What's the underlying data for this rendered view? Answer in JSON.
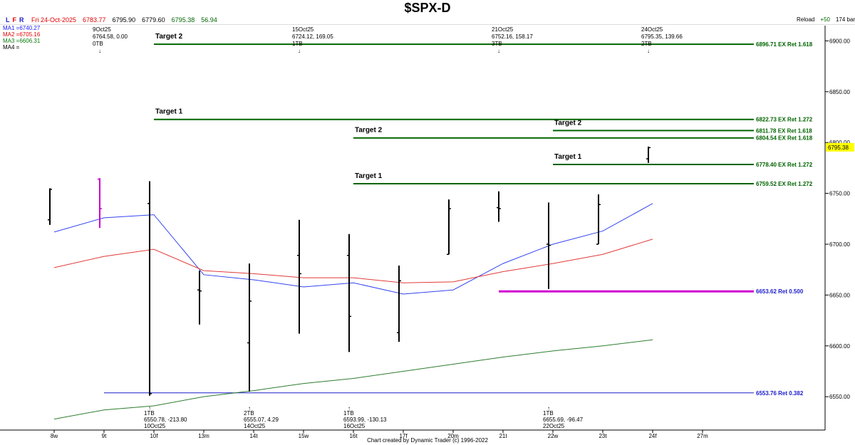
{
  "header": {
    "title": "$SPX-D",
    "lfr": [
      "L",
      "F",
      "R"
    ],
    "ohlc": {
      "date": "Fri 24-Oct-2025",
      "open": "6783.77",
      "high": "6795.90",
      "low": "6779.60",
      "close": "6795.38",
      "change": "56.94"
    },
    "reload_label": "Reload",
    "plus_label": "+50",
    "bars_label": "174 bars"
  },
  "moving_averages": [
    {
      "label": "MA1 =6740.27",
      "color": "#1a1aff"
    },
    {
      "label": "MA2 =6705.16",
      "color": "#e00000"
    },
    {
      "label": "MA3 =6606.31",
      "color": "#0a7a0a"
    },
    {
      "label": "MA4 =",
      "color": "#000000"
    }
  ],
  "footer": "Chart created by Dynamic Trader  (c) 1996-2022",
  "colors": {
    "target_line": "#006400",
    "ma1": "#3344ee",
    "ma2": "#e23a3a",
    "ma3": "#2e7d2e",
    "ret_blue": "#1a1acc",
    "ret_magenta": "#d000d0",
    "price_tag": "#ffff00"
  },
  "chart_data": {
    "type": "ohlc",
    "title": "$SPX-D",
    "ylim": [
      6520,
      6915
    ],
    "y_ticks": [
      6550,
      6600,
      6650,
      6700,
      6750,
      6800,
      6850,
      6900
    ],
    "y_tick_labels": [
      "6550.00",
      "6600.00",
      "6650.00",
      "6700.00",
      "6750.00",
      "6800.00",
      "6850.00",
      "6900.00"
    ],
    "categories": [
      "8w",
      "9t",
      "10f",
      "13m",
      "14t",
      "15w",
      "16t",
      "17f",
      "20m",
      "21t",
      "22w",
      "23t",
      "24f",
      "27m"
    ],
    "bars": [
      {
        "x": "8w",
        "open": 6724,
        "high": 6755,
        "low": 6719,
        "close": 6754
      },
      {
        "x": "9t",
        "open": 6764,
        "high": 6765,
        "low": 6716,
        "close": 6735,
        "highlight": true
      },
      {
        "x": "10f",
        "open": 6740,
        "high": 6762,
        "low": 6551,
        "close": 6553
      },
      {
        "x": "13m",
        "open": 6655,
        "high": 6674,
        "low": 6621,
        "close": 6654
      },
      {
        "x": "14t",
        "open": 6603,
        "high": 6681,
        "low": 6555,
        "close": 6644
      },
      {
        "x": "15w",
        "open": 6689,
        "high": 6724,
        "low": 6612,
        "close": 6671
      },
      {
        "x": "16t",
        "open": 6689,
        "high": 6710,
        "low": 6594,
        "close": 6629
      },
      {
        "x": "17f",
        "open": 6613,
        "high": 6679,
        "low": 6604,
        "close": 6664
      },
      {
        "x": "20m",
        "open": 6690,
        "high": 6744,
        "low": 6690,
        "close": 6735
      },
      {
        "x": "21t",
        "open": 6736,
        "high": 6752,
        "low": 6722,
        "close": 6735
      },
      {
        "x": "22w",
        "open": 6700,
        "high": 6741,
        "low": 6656,
        "close": 6699
      },
      {
        "x": "23t",
        "open": 6700,
        "high": 6749,
        "low": 6700,
        "close": 6739
      },
      {
        "x": "24f",
        "open": 6784,
        "high": 6796,
        "low": 6780,
        "close": 6795
      }
    ],
    "series": [
      {
        "name": "MA1",
        "x": [
          "8w",
          "9t",
          "10f",
          "13m",
          "14t",
          "15w",
          "16t",
          "17f",
          "20m",
          "21t",
          "22w",
          "23t",
          "24f"
        ],
        "values": [
          6712,
          6726,
          6729,
          6670,
          6665,
          6658,
          6662,
          6651,
          6655,
          6681,
          6700,
          6713,
          6740
        ]
      },
      {
        "name": "MA2",
        "x": [
          "8w",
          "9t",
          "10f",
          "13m",
          "14t",
          "15w",
          "16t",
          "17f",
          "20m",
          "21t",
          "22w",
          "23t",
          "24f"
        ],
        "values": [
          6677,
          6688,
          6695,
          6674,
          6671,
          6667,
          6667,
          6662,
          6663,
          6673,
          6681,
          6690,
          6705
        ]
      },
      {
        "name": "MA3",
        "x": [
          "8w",
          "9t",
          "10f",
          "13m",
          "14t",
          "15w",
          "16t",
          "17f",
          "20m",
          "21t",
          "22w",
          "23t",
          "24f"
        ],
        "values": [
          6528,
          6537,
          6541,
          6550,
          6556,
          6563,
          6568,
          6575,
          6582,
          6589,
          6595,
          6600,
          6606
        ]
      }
    ],
    "target_lines": [
      {
        "value": 6896.71,
        "from": "10f",
        "label": "6896.71 EX Ret 1.618",
        "tag": "Target 2"
      },
      {
        "value": 6822.73,
        "from": "10f",
        "label": "6822.73 EX Ret 1.272",
        "tag": "Target 1"
      },
      {
        "value": 6811.78,
        "from": "22w",
        "label": "6811.78 EX Ret 1.618",
        "tag": "Target 2"
      },
      {
        "value": 6804.54,
        "from": "16t",
        "label": "6804.54 EX Ret 1.618",
        "tag": "Target 2"
      },
      {
        "value": 6778.4,
        "from": "22w",
        "label": "6778.40 EX Ret 1.272",
        "tag": "Target 1"
      },
      {
        "value": 6759.52,
        "from": "16t",
        "label": "6759.52 EX Ret 1.272",
        "tag": "Target 1"
      }
    ],
    "retracement_lines": [
      {
        "value": 6653.62,
        "from": "21t",
        "to": "24f",
        "label": "6653.62 Ret 0.500",
        "color": "magenta"
      },
      {
        "value": 6553.76,
        "from": "9t",
        "label": "6553.76 Ret 0.382",
        "color": "blue"
      }
    ],
    "last_price_tag": "6795.38",
    "pivot_annotations_top": [
      {
        "x": "9t",
        "lines": [
          "9Oct25",
          "6764.58, 0.00",
          "0TB"
        ]
      },
      {
        "x": "15w",
        "lines": [
          "15Oct25",
          "6724.12, 169.05",
          "1TB"
        ]
      },
      {
        "x": "21t",
        "lines": [
          "21Oct25",
          "6752.16, 158.17",
          "3TB"
        ]
      },
      {
        "x": "24f",
        "lines": [
          "24Oct25",
          "6795.35, 139.66",
          "2TB"
        ]
      }
    ],
    "pivot_annotations_bottom": [
      {
        "x": "10f",
        "lines": [
          "1TB",
          "6550.78, -213.80",
          "10Oct25"
        ]
      },
      {
        "x": "14t",
        "lines": [
          "2TB",
          "6555.07, 4.29",
          "14Oct25"
        ]
      },
      {
        "x": "16t",
        "lines": [
          "1TB",
          "6593.99, -130.13",
          "16Oct25"
        ]
      },
      {
        "x": "22w",
        "lines": [
          "1TB",
          "6655.69, -96.47",
          "22Oct25"
        ]
      }
    ]
  }
}
